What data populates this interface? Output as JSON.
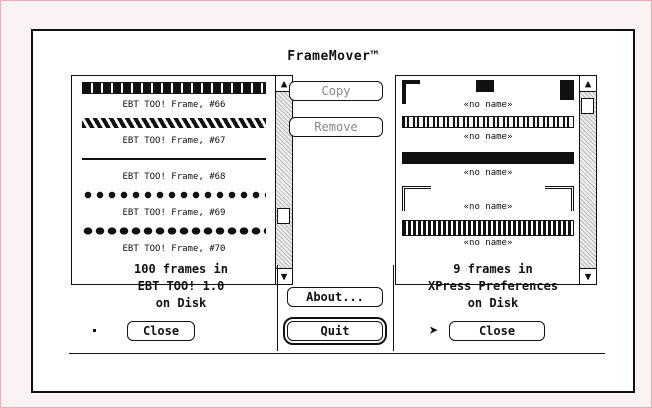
{
  "app": {
    "title": "FrameMover™"
  },
  "left_list": {
    "items": [
      {
        "label": "EBT TOO! Frame, #66"
      },
      {
        "label": "EBT TOO! Frame, #67"
      },
      {
        "label": "EBT TOO! Frame, #68"
      },
      {
        "label": "EBT TOO! Frame, #69"
      },
      {
        "label": "EBT TOO! Frame, #70"
      }
    ],
    "info_line1": "100 frames in",
    "info_line2": "EBT TOO! 1.0",
    "info_line3": "on Disk",
    "close_label": "Close"
  },
  "right_list": {
    "items": [
      {
        "label": "«no name»"
      },
      {
        "label": "«no name»"
      },
      {
        "label": "«no name»"
      },
      {
        "label": "«no name»"
      },
      {
        "label": "«no name»"
      }
    ],
    "info_line1": "9 frames in",
    "info_line2": "XPress Preferences",
    "info_line3": "on Disk",
    "close_label": "Close"
  },
  "buttons": {
    "copy": "Copy",
    "remove": "Remove",
    "about": "About...",
    "quit": "Quit"
  },
  "icons": {
    "scroll_up": "▲",
    "scroll_down": "▼",
    "cursor": "pointer-arrow"
  }
}
